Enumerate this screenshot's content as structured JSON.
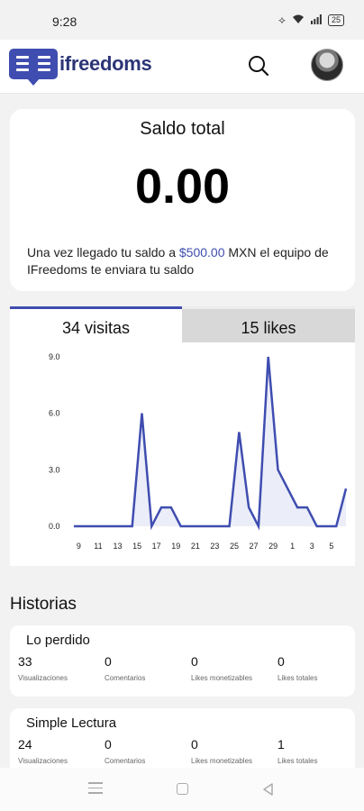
{
  "status_bar": {
    "time": "9:28",
    "battery": "25"
  },
  "header": {
    "app_name": "ifreedoms"
  },
  "balance": {
    "title": "Saldo total",
    "amount": "0.00",
    "note_prefix": "Una vez llegado tu saldo a ",
    "note_amount": "$500.00",
    "note_suffix": " MXN el equipo de IFreedoms te enviara tu saldo"
  },
  "tabs": {
    "visits": "34 visitas",
    "likes": "15 likes"
  },
  "chart_data": {
    "type": "area",
    "title": "",
    "xlabel": "",
    "ylabel": "",
    "ylim": [
      0,
      9
    ],
    "y_ticks": [
      "0.0",
      "3.0",
      "6.0",
      "9.0"
    ],
    "x_tick_labels": [
      "9",
      "11",
      "13",
      "15",
      "17",
      "19",
      "21",
      "23",
      "25",
      "27",
      "29",
      "1",
      "3",
      "5"
    ],
    "series": [
      {
        "values": [
          0,
          0,
          0,
          0,
          0,
          0,
          0,
          6,
          0,
          1,
          1,
          0,
          0,
          0,
          0,
          0,
          0,
          5,
          1,
          0,
          9,
          3,
          2,
          1,
          1,
          0,
          0,
          0,
          2
        ]
      }
    ],
    "color": "#3f4db0",
    "fill": "#ebeef8",
    "grid": false
  },
  "stories_section": {
    "title": "Historias"
  },
  "stories": [
    {
      "title": "Lo perdido",
      "stats": [
        {
          "value": "33",
          "label": "Visualizaciones"
        },
        {
          "value": "0",
          "label": "Comentarios"
        },
        {
          "value": "0",
          "label": "Likes monetizables"
        },
        {
          "value": "0",
          "label": "Likes totales"
        }
      ]
    },
    {
      "title": "Simple Lectura",
      "stats": [
        {
          "value": "24",
          "label": "Visualizaciones"
        },
        {
          "value": "0",
          "label": "Comentarios"
        },
        {
          "value": "0",
          "label": "Likes monetizables"
        },
        {
          "value": "1",
          "label": "Likes totales"
        }
      ]
    }
  ],
  "icons": {
    "search": "search-icon",
    "avatar": "avatar",
    "nav_menu": "menu-icon",
    "nav_home": "home-icon",
    "nav_back": "back-icon"
  }
}
